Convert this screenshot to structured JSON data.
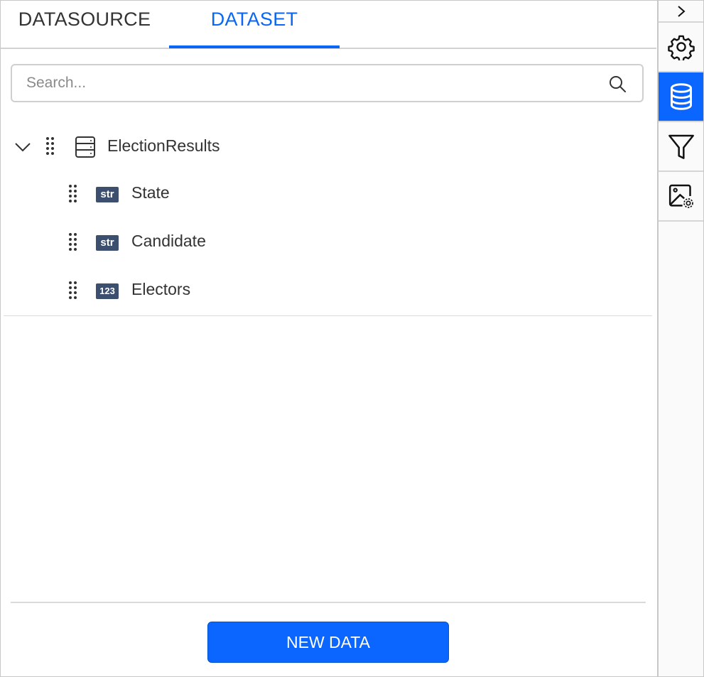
{
  "tabs": [
    {
      "label": "DATASOURCE",
      "active": false
    },
    {
      "label": "DATASET",
      "active": true
    }
  ],
  "search": {
    "placeholder": "Search...",
    "value": "",
    "icon": "search-icon"
  },
  "dataset": {
    "name": "ElectionResults",
    "expanded": true,
    "icon": "dataset-table-icon",
    "fields": [
      {
        "type": "str",
        "name": "State"
      },
      {
        "type": "str",
        "name": "Candidate"
      },
      {
        "type": "123",
        "name": "Electors"
      }
    ]
  },
  "footer": {
    "new_data_label": "NEW DATA"
  },
  "rail": {
    "items": [
      {
        "name": "collapse",
        "icon": "chevron-right-icon"
      },
      {
        "name": "properties",
        "icon": "gear-icon"
      },
      {
        "name": "data",
        "icon": "database-icon",
        "active": true
      },
      {
        "name": "filter",
        "icon": "filter-icon"
      },
      {
        "name": "image-settings",
        "icon": "image-settings-icon"
      }
    ]
  },
  "colors": {
    "accent": "#0a66ff",
    "badge": "#3d4f6e",
    "text": "#333333"
  }
}
